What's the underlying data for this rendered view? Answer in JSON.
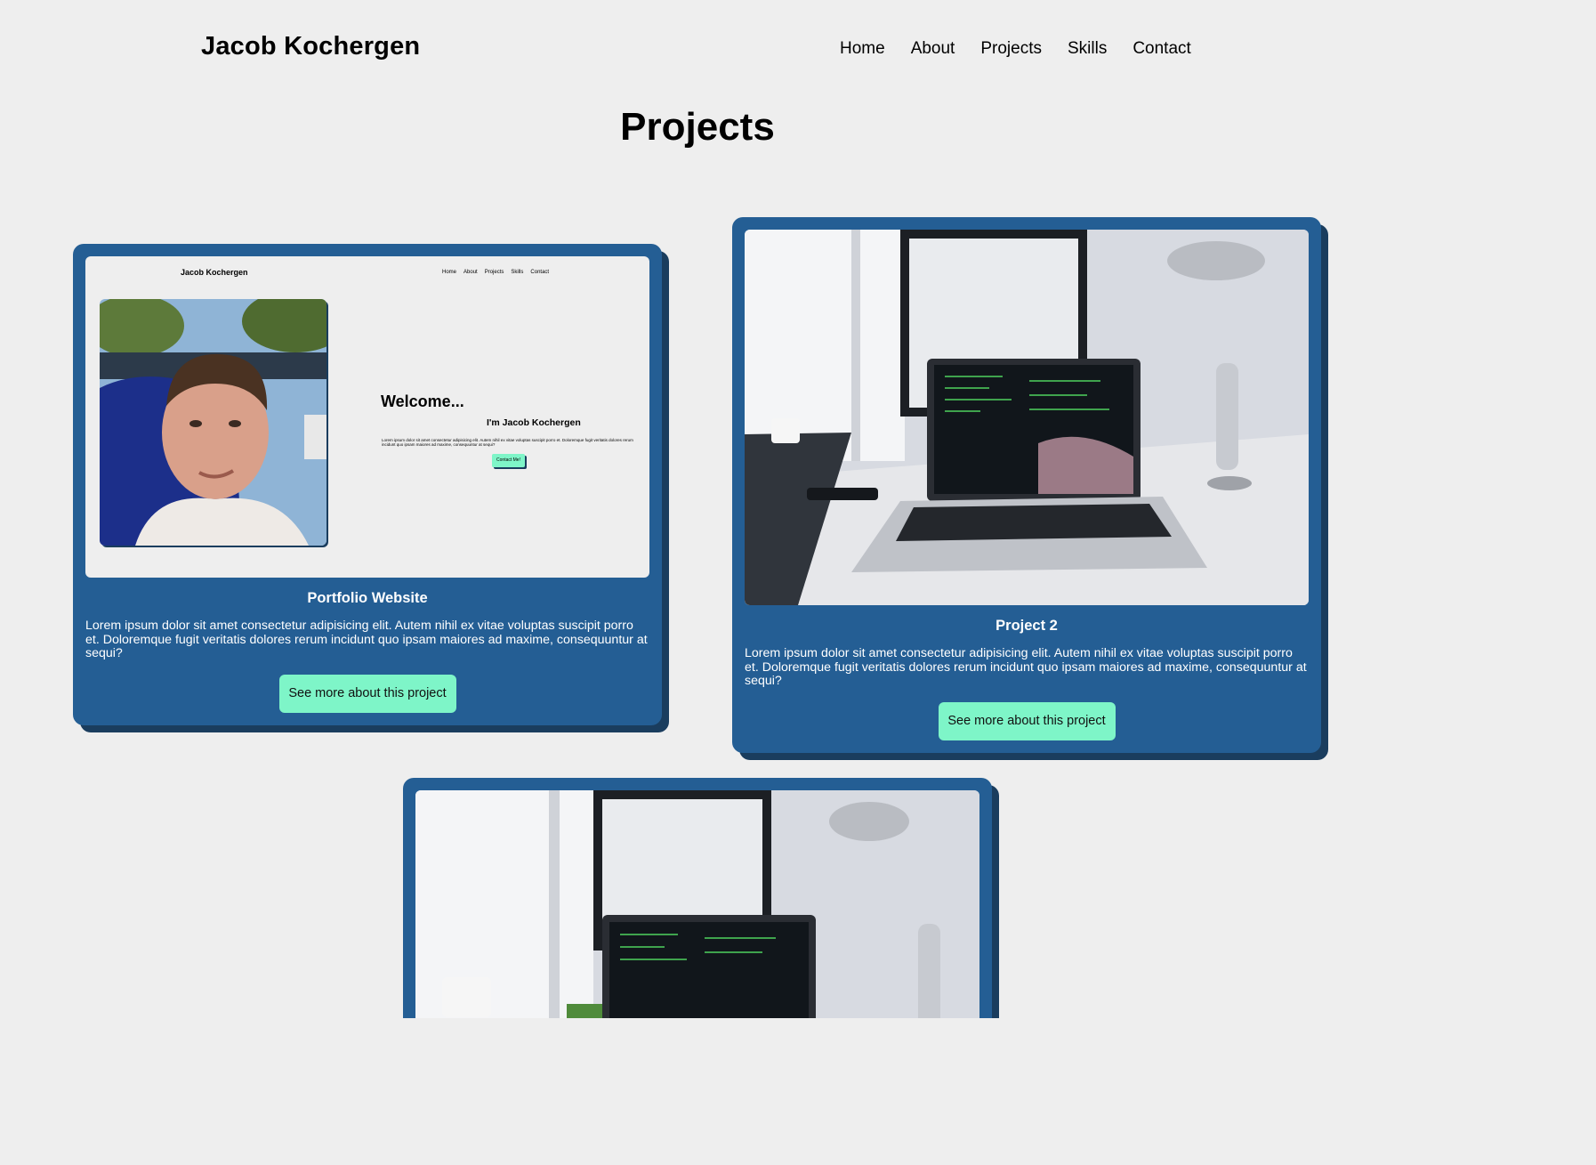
{
  "header": {
    "brand": "Jacob Kochergen",
    "nav": [
      "Home",
      "About",
      "Projects",
      "Skills",
      "Contact"
    ]
  },
  "page_title": "Projects",
  "projects": [
    {
      "title": "Portfolio Website",
      "description": "Lorem ipsum dolor sit amet consectetur adipisicing elit. Autem nihil ex vitae voluptas suscipit porro et. Doloremque fugit veritatis dolores rerum incidunt quo ipsam maiores ad maxime, consequuntur at sequi?",
      "button": "See more about this project",
      "screenshot": {
        "brand": "Jacob Kochergen",
        "nav": [
          "Home",
          "About",
          "Projects",
          "Skills",
          "Contact"
        ],
        "welcome": "Welcome...",
        "subtitle": "I'm Jacob Kochergen",
        "body": "Lorem ipsum dolor sit amet consectetur adipisicing elit. Autem nihil ex vitae voluptas suscipit porro et. Doloremque fugit veritatis dolores rerum incidunt quo ipsam maiores ad maxime, consequuntur at sequi?",
        "contact_button": "Contact Me!"
      }
    },
    {
      "title": "Project 2",
      "description": "Lorem ipsum dolor sit amet consectetur adipisicing elit. Autem nihil ex vitae voluptas suscipit porro et. Doloremque fugit veritatis dolores rerum incidunt quo ipsam maiores ad maxime, consequuntur at sequi?",
      "button": "See more about this project"
    },
    {
      "title": "",
      "description": "",
      "button": ""
    }
  ],
  "colors": {
    "background": "#eeeeee",
    "card": "#245e94",
    "card_shadow": "#1a3d5e",
    "button": "#7ef5c8"
  }
}
